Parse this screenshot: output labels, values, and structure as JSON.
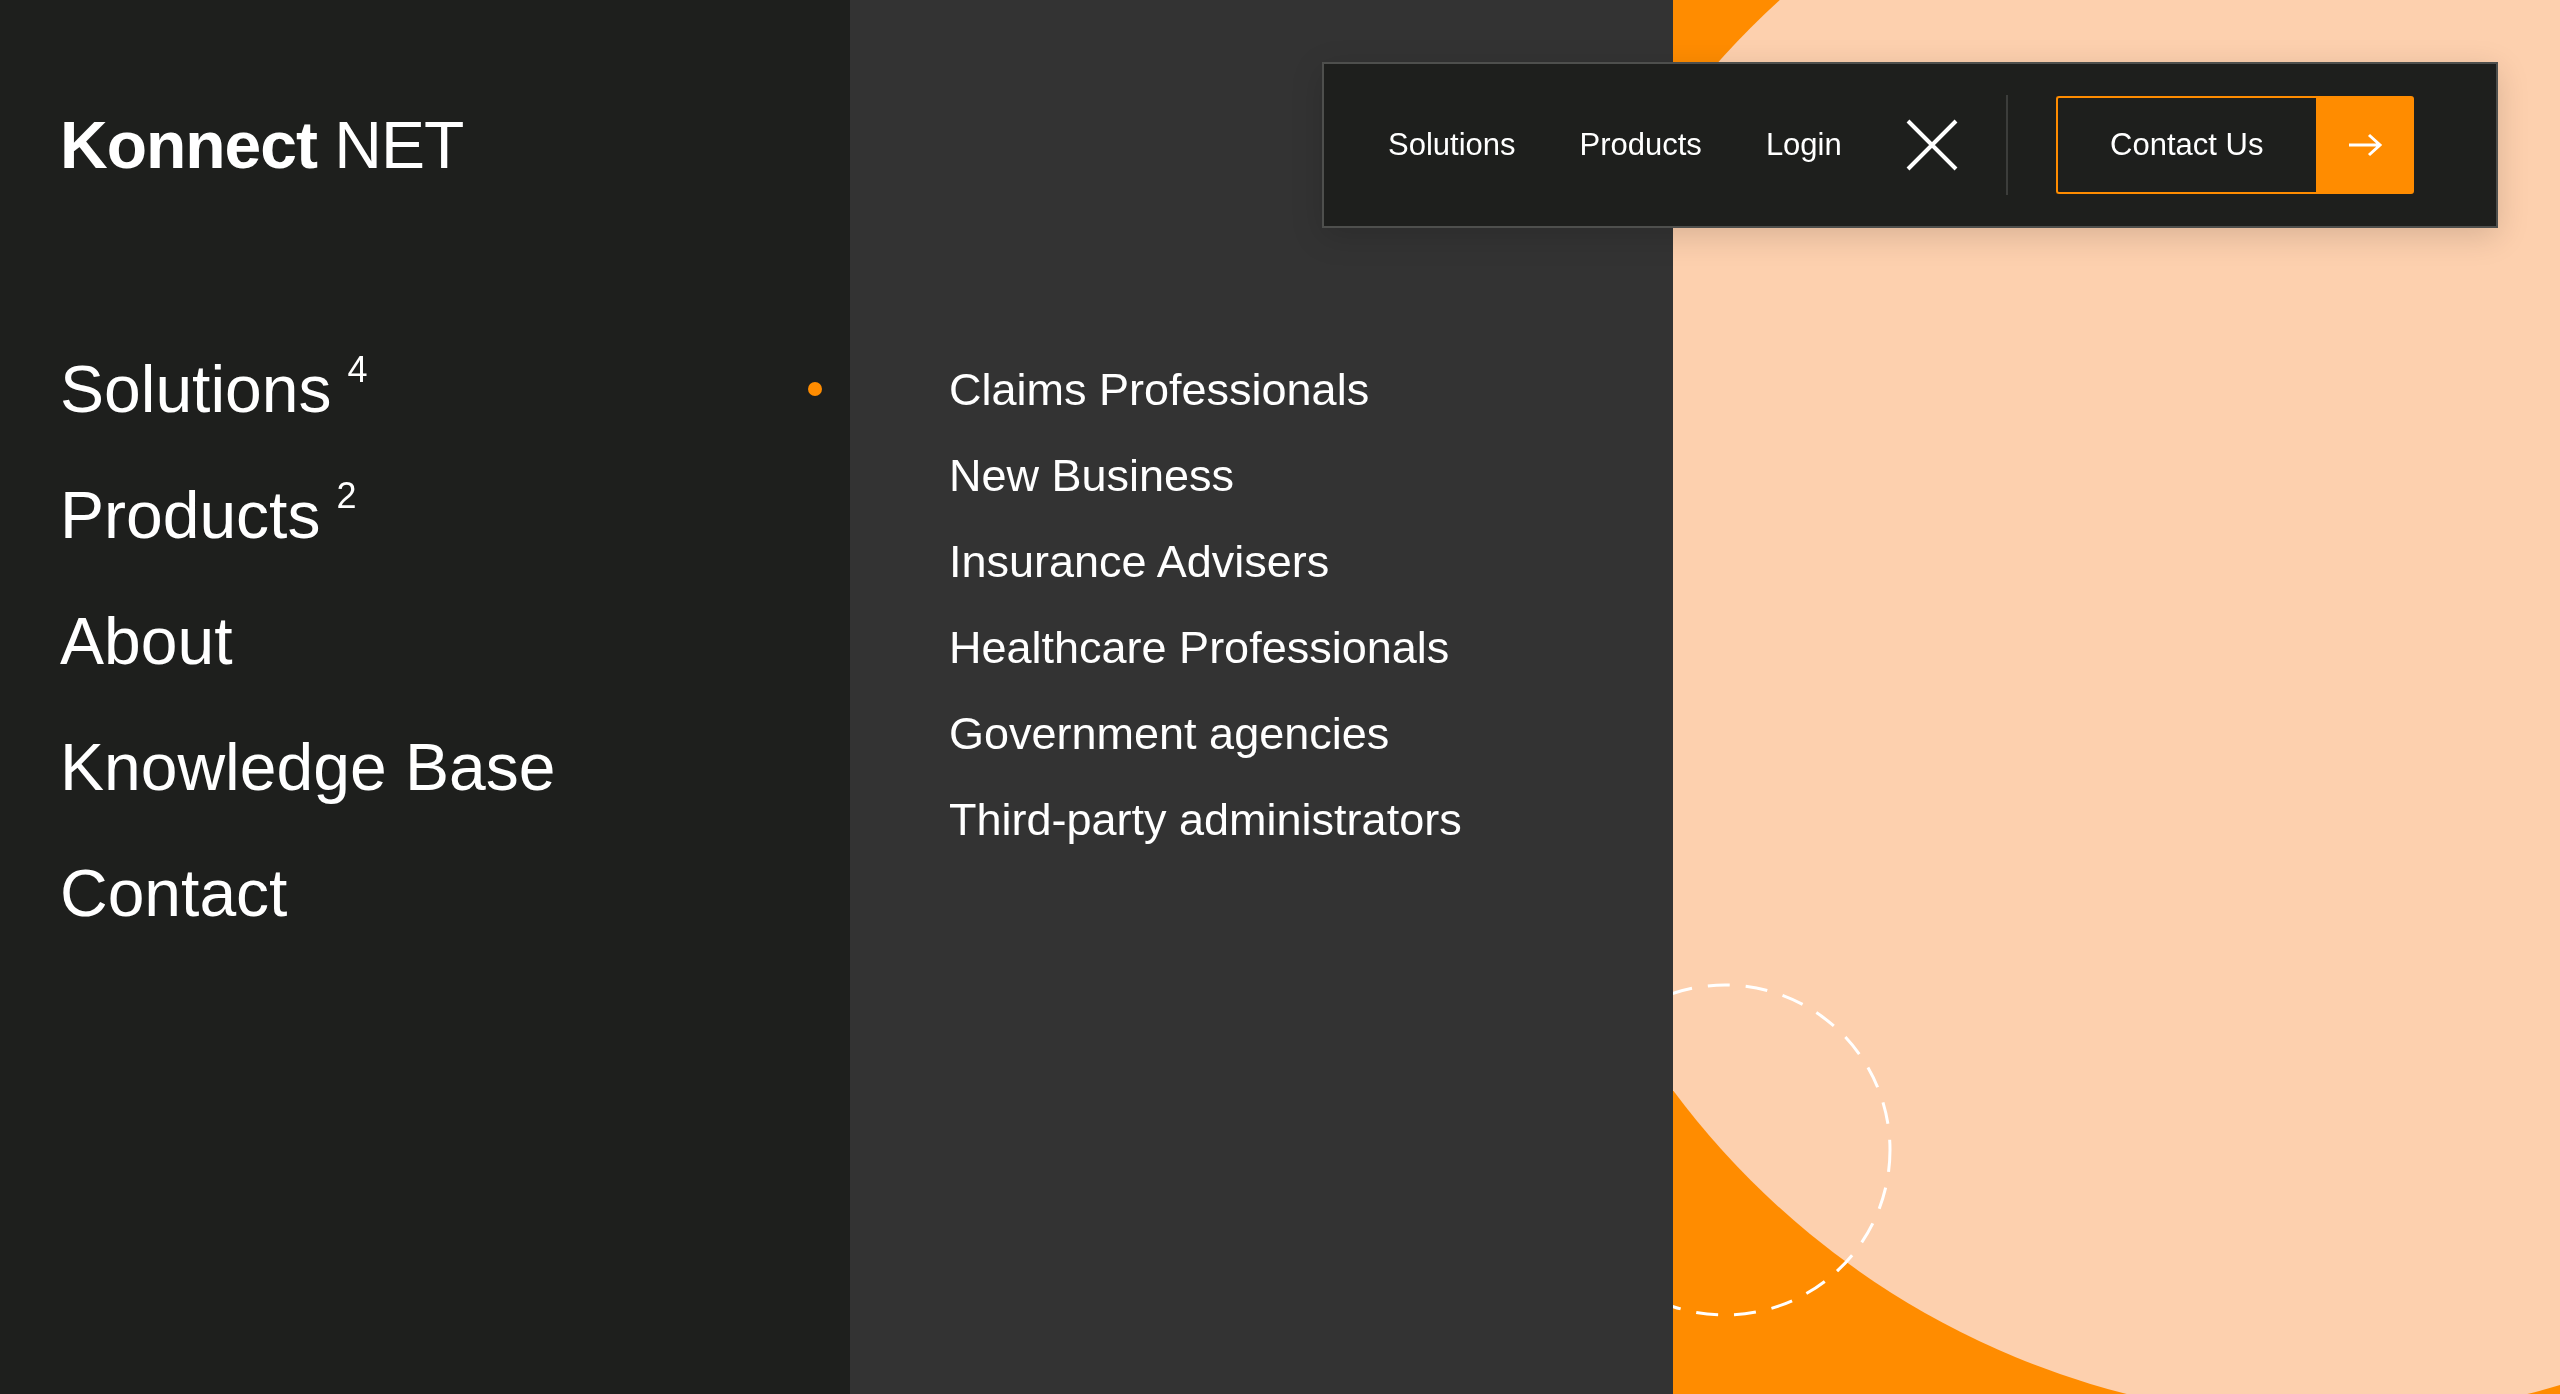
{
  "logo": "**Konnect** NET",
  "header": {
    "links": [
      "Solutions",
      "Products",
      "Login"
    ],
    "contact_button": "Contact Us"
  },
  "menu": [
    {
      "label": "Solutions",
      "count": "4",
      "selected": true
    },
    {
      "label": "Products",
      "count": "2",
      "selected": false
    },
    {
      "label": "About",
      "selected": false
    },
    {
      "label": "Knowledge Base",
      "selected": false
    },
    {
      "label": "Contact",
      "selected": false
    }
  ],
  "submenu": [
    "Claims Professionals",
    "New Business",
    "Insurance Advisers",
    "Healthcare Professionals",
    "Government agencies",
    "Third-party administrators"
  ]
}
